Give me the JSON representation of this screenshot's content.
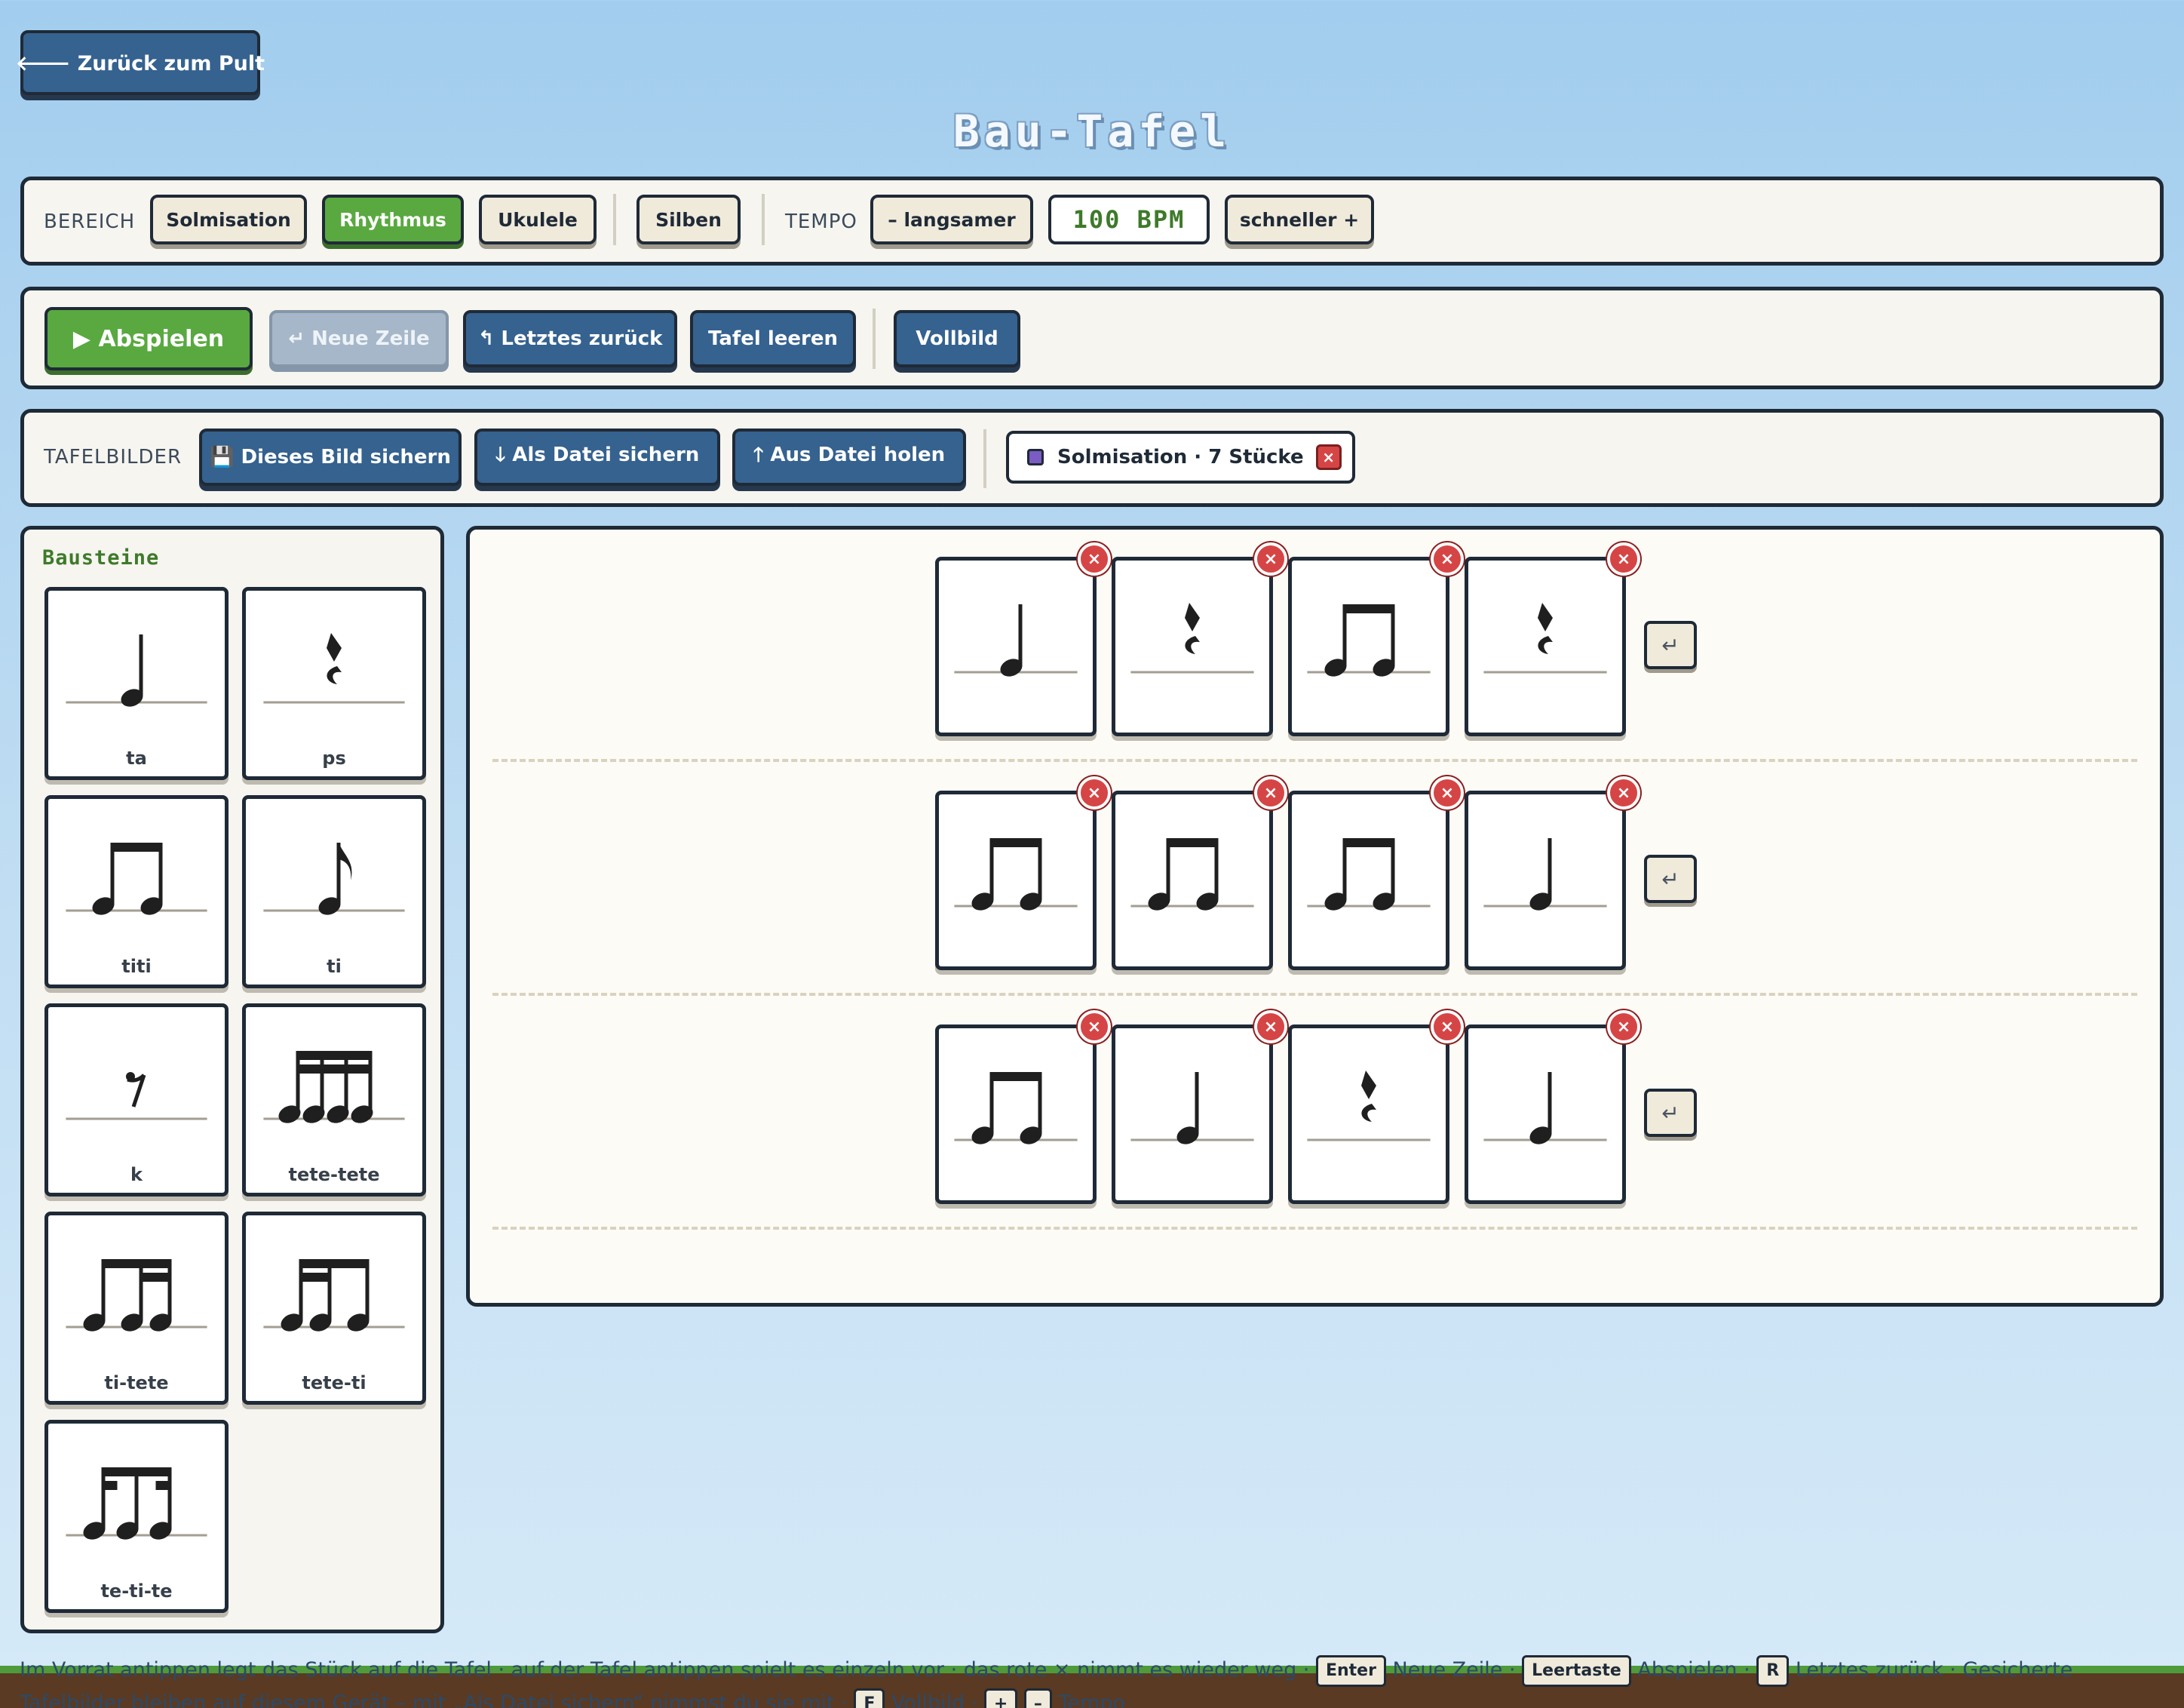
{
  "nav": {
    "back_label": "🡐 Zurück zum Pult"
  },
  "page": {
    "title": "Bau-Tafel"
  },
  "bereich": {
    "label": "BEREICH",
    "options": [
      "Solmisation",
      "Rhythmus",
      "Ukulele"
    ],
    "active": "Rhythmus",
    "silben_label": "Silben"
  },
  "tempo": {
    "label": "TEMPO",
    "slower_label": "– langsamer",
    "bpm_display": "100 BPM",
    "bpm": 100,
    "faster_label": "schneller +"
  },
  "actions": {
    "play_label": "▶ Abspielen",
    "new_row_label": "↵ Neue Zeile",
    "undo_label": "↰ Letztes zurück",
    "clear_label": "Tafel leeren",
    "fullscreen_label": "Vollbild"
  },
  "tafelbilder": {
    "label": "TAFELBILDER",
    "save_label": "💾 Dieses Bild sichern",
    "export_label": "🡓 Als Datei sichern",
    "import_label": "🡑 Aus Datei holen",
    "saved_item": "Solmisation · 7 Stücke",
    "saved_item_color": "#7b5bc4"
  },
  "palette": {
    "title": "Bausteine",
    "items": [
      {
        "label": "ta",
        "glyph": "quarter-note-icon"
      },
      {
        "label": "ps",
        "glyph": "quarter-rest-icon"
      },
      {
        "label": "titi",
        "glyph": "eighth-pair-icon"
      },
      {
        "label": "ti",
        "glyph": "eighth-note-icon"
      },
      {
        "label": "k",
        "glyph": "eighth-rest-icon"
      },
      {
        "label": "tete-tete",
        "glyph": "sixteenth-group-icon"
      },
      {
        "label": "ti-tete",
        "glyph": "eighth-two-sixteenths-icon"
      },
      {
        "label": "tete-ti",
        "glyph": "two-sixteenths-eighth-icon"
      },
      {
        "label": "te-ti-te",
        "glyph": "syncopa-sixteenth-icon"
      }
    ]
  },
  "board": {
    "rows": [
      [
        "ta",
        "ps",
        "titi",
        "ps"
      ],
      [
        "titi",
        "titi",
        "titi",
        "ta"
      ],
      [
        "titi",
        "ta",
        "ps",
        "ta"
      ]
    ],
    "delete_glyph": "×",
    "enter_glyph": "↵"
  },
  "hint": {
    "part1": "Im Vorrat antippen legt das Stück auf die Tafel · auf der Tafel antippen spielt es einzeln vor · das rote × nimmt es wieder weg ·",
    "key_enter": "Enter",
    "part2": "Neue Zeile ·",
    "key_space": "Leertaste",
    "part3": "Abspielen ·",
    "key_r": "R",
    "part4": "Letztes zurück · Gesicherte Tafelbilder bleiben auf diesem Gerät – mit „Als Datei sichern“ nimmst du sie mit ·",
    "key_f": "F",
    "part5": "Vollbild ·",
    "key_plus": "+",
    "key_minus": "–",
    "part6": "Tempo"
  },
  "colors": {
    "accent_green": "#59a940",
    "button_blue": "#35628f",
    "delete_red": "#d64545",
    "title_green": "#3e7a2a"
  }
}
